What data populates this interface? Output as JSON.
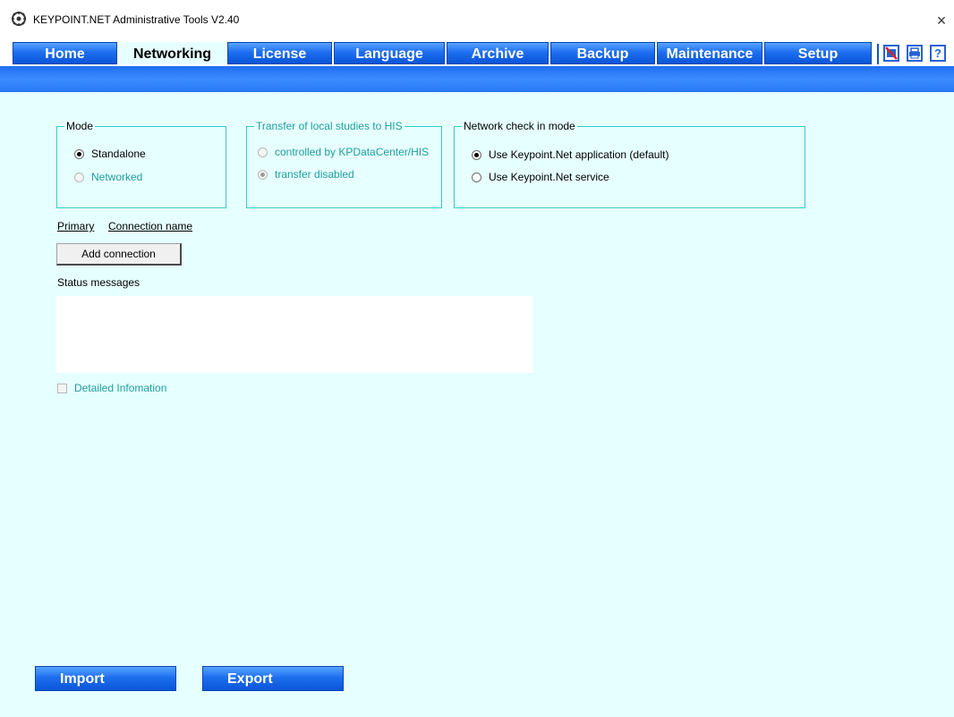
{
  "window": {
    "title": "KEYPOINT.NET Administrative Tools V2.40",
    "close_glyph": "×"
  },
  "tabs": [
    {
      "label": "Home",
      "active": false
    },
    {
      "label": "Networking",
      "active": true
    },
    {
      "label": "License",
      "active": false
    },
    {
      "label": "Language",
      "active": false
    },
    {
      "label": "Archive",
      "active": false
    },
    {
      "label": "Backup",
      "active": false
    },
    {
      "label": "Maintenance",
      "active": false
    },
    {
      "label": "Setup",
      "active": false
    }
  ],
  "toolbar_icons": [
    {
      "name": "no-network-icon"
    },
    {
      "name": "printer-icon"
    },
    {
      "name": "help-icon",
      "glyph": "?"
    }
  ],
  "mode_group": {
    "title": "Mode",
    "options": [
      {
        "label": "Standalone",
        "checked": true,
        "enabled": true
      },
      {
        "label": "Networked",
        "checked": false,
        "enabled": false
      }
    ]
  },
  "transfer_group": {
    "title": "Transfer of local studies to HIS",
    "options": [
      {
        "label": "controlled by KPDataCenter/HIS",
        "checked": false,
        "enabled": false
      },
      {
        "label": "transfer disabled",
        "checked": true,
        "enabled": false
      }
    ]
  },
  "network_check_group": {
    "title": "Network check in mode",
    "options": [
      {
        "label": "Use Keypoint.Net application (default)",
        "checked": true,
        "enabled": true
      },
      {
        "label": "Use Keypoint.Net service",
        "checked": false,
        "enabled": true
      }
    ]
  },
  "connections": {
    "col_primary": "Primary",
    "col_name": "Connection name",
    "add_button": "Add connection"
  },
  "status": {
    "label": "Status messages",
    "messages": ""
  },
  "detailed_info": {
    "label": "Detailed Infomation",
    "checked": false,
    "enabled": false
  },
  "footer": {
    "import_label": "Import",
    "export_label": "Export"
  },
  "colors": {
    "background": "#e6ffff",
    "tab_blue": "#1e6ff0",
    "group_border": "#33cccc",
    "disabled_text": "#1f9e9e"
  }
}
